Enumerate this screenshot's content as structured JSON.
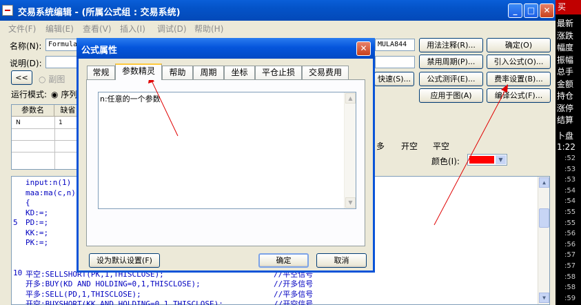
{
  "window": {
    "title": "交易系统编辑 - (所属公式组 : 交易系统)",
    "minimize": "_",
    "maximize": "□",
    "close": "✕"
  },
  "menu": [
    "文件(F)",
    "编辑(E)",
    "查看(V)",
    "插入(I)",
    "调试(D)",
    "帮助(H)"
  ],
  "form": {
    "name_label": "名称(N):",
    "name_value": "Formula",
    "name_value_right": "MULA844",
    "desc_label": "说明(D):",
    "nav_prev": "<<",
    "subchart_label": "副图",
    "runmode_label": "运行模式:",
    "runmode_option": "序列",
    "fast_btn": "快速(S)..."
  },
  "buttons_right": {
    "usage_note": "用法注释(R)...",
    "ok": "确定(O)",
    "disable_period": "禁用周期(P)...",
    "import_formula": "引入公式(O)...",
    "formula_test": "公式测评(E)...",
    "fee_settings": "费率设置(B)...",
    "apply_to_chart": "应用于图(A)",
    "compile": "编译公式(F)..."
  },
  "param_table": {
    "col_name": "参数名",
    "col_default": "缺省",
    "rows": [
      {
        "name": "N",
        "default": "1"
      }
    ]
  },
  "signal_tabs": [
    "多",
    "开空",
    "平空"
  ],
  "color_label": "颜色(I):",
  "color_value": "#ff0000",
  "code": {
    "lines": [
      {
        "no": "",
        "text": "input:n(1)",
        "comment": ""
      },
      {
        "no": "",
        "text": "maa:ma(c,n),",
        "comment": ""
      },
      {
        "no": "",
        "text": "{",
        "comment": ""
      },
      {
        "no": "",
        "text": "KD:=;",
        "comment": ""
      },
      {
        "no": "5",
        "text": "PD:=;",
        "comment": ""
      },
      {
        "no": "",
        "text": "KK:=;",
        "comment": ""
      },
      {
        "no": "",
        "text": "PK:=;",
        "comment": ""
      },
      {
        "no": "",
        "text": "",
        "comment": ""
      },
      {
        "no": "",
        "text": "",
        "comment": ""
      },
      {
        "no": "10",
        "text": "平空:SELLSHORT(PK,1,THISCLOSE);",
        "comment": "//平空信号"
      },
      {
        "no": "",
        "text": "开多:BUY(KD AND HOLDING=0,1,THISCLOSE);",
        "comment": "//开多信号"
      },
      {
        "no": "",
        "text": "平多:SELL(PD,1,THISCLOSE);",
        "comment": "//平多信号"
      },
      {
        "no": "",
        "text": "开空:BUYSHORT(KK AND HOLDING=0,1,THISCLOSE);",
        "comment": "//开空信号"
      }
    ]
  },
  "right_strip": {
    "top_tag": "买",
    "items": [
      "最新",
      "涨跌",
      "幅度",
      "振幅",
      "总手",
      "金额",
      "持仓",
      "涨停",
      "结算"
    ],
    "section": "卜盘",
    "big_time": "1:22",
    "times": [
      ":52",
      ":53",
      ":53",
      ":54",
      ":54",
      ":55",
      ":55",
      ":56",
      ":56",
      ":57",
      ":57",
      ":58",
      ":58",
      ":59"
    ]
  },
  "dialog": {
    "title": "公式属性",
    "close": "✕",
    "tabs": [
      "常规",
      "参数精灵",
      "帮助",
      "周期",
      "坐标",
      "平仓止损",
      "交易费用"
    ],
    "active_tab": "参数精灵",
    "help_text": "n:任意的一个参数",
    "btn_set_default": "设为默认设置(F)",
    "btn_ok": "确定",
    "btn_cancel": "取消"
  },
  "icons": {
    "up": "▲",
    "down": "▼",
    "dropdown": "▼"
  }
}
